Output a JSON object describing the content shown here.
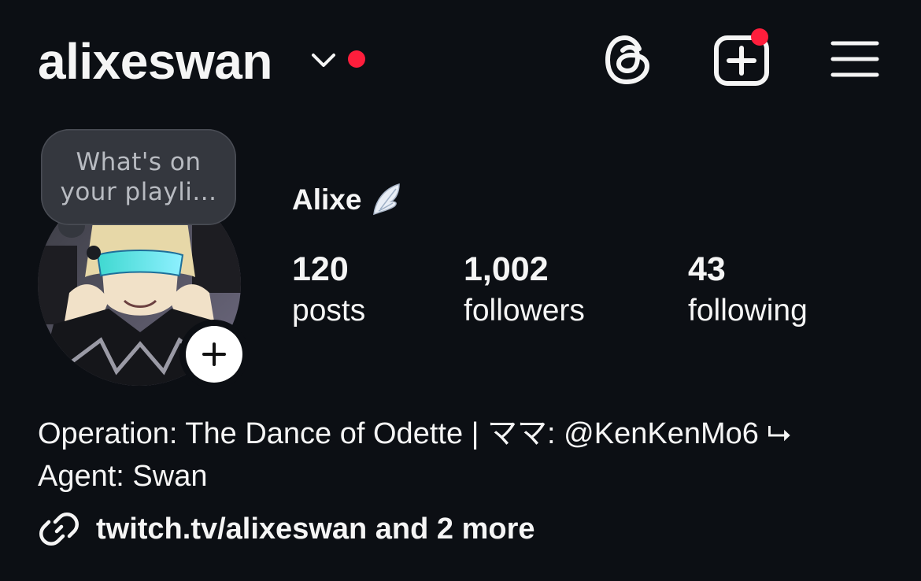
{
  "header": {
    "username": "alixeswan",
    "account_switcher_icon": "chevron-down-icon",
    "notification_color": "#ff1e3c",
    "actions": [
      {
        "name": "threads",
        "icon": "threads-icon"
      },
      {
        "name": "create",
        "icon": "plus-square-icon"
      },
      {
        "name": "menu",
        "icon": "hamburger-menu-icon"
      }
    ]
  },
  "profile": {
    "note_text": "What's on your playli...",
    "display_name": "Alixe",
    "name_emoji": "wing-icon",
    "avatar_overlay_icon": "plus-icon"
  },
  "stats": {
    "posts": {
      "value": "120",
      "label": "posts"
    },
    "followers": {
      "value": "1,002",
      "label": "followers"
    },
    "following": {
      "value": "43",
      "label": "following"
    }
  },
  "bio": {
    "line1": "Operation: The Dance of Odette | ママ: @KenKenMo6 ⮡",
    "line2": "Agent: Swan"
  },
  "link": {
    "icon": "link-icon",
    "text": "twitch.tv/alixeswan and 2 more"
  },
  "colors": {
    "background": "#0c0f14",
    "text": "#f5f5f5",
    "note_bubble": "#34373e",
    "badge_red": "#ff1e3c"
  }
}
